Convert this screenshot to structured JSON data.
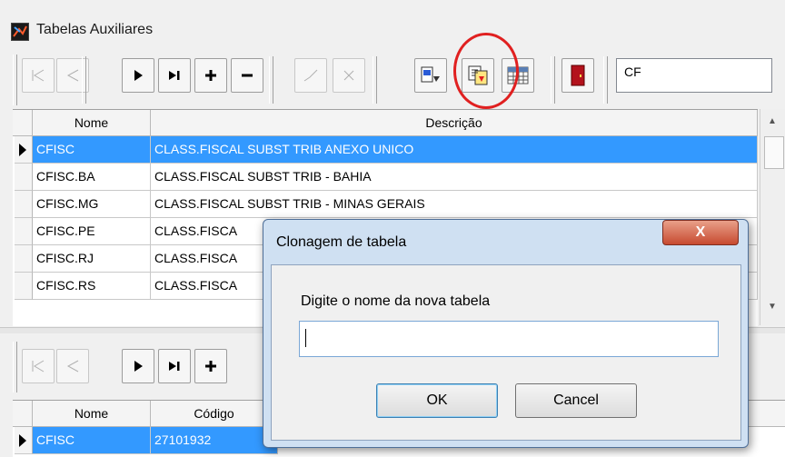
{
  "window": {
    "title": "Tabelas Auxiliares"
  },
  "toolbar_top": {
    "filter_value": "CF",
    "buttons": [
      "first-icon",
      "prior-icon",
      "next-icon",
      "last-icon",
      "plus-icon",
      "minus-icon",
      "edit-icon",
      "cancel-x-icon",
      "refresh-icon",
      "clone-table-icon",
      "grid-icon",
      "exit-door-icon"
    ]
  },
  "grid_top": {
    "columns": [
      "Nome",
      "Descrição"
    ],
    "rows": [
      [
        "CFISC",
        "CLASS.FISCAL SUBST TRIB ANEXO UNICO"
      ],
      [
        "CFISC.BA",
        "CLASS.FISCAL SUBST TRIB - BAHIA"
      ],
      [
        "CFISC.MG",
        "CLASS.FISCAL SUBST TRIB - MINAS GERAIS"
      ],
      [
        "CFISC.PE",
        "CLASS.FISCA"
      ],
      [
        "CFISC.RJ",
        "CLASS.FISCA"
      ],
      [
        "CFISC.RS",
        "CLASS.FISCA"
      ]
    ]
  },
  "grid_bottom": {
    "columns": [
      "Nome",
      "Código"
    ],
    "rows": [
      [
        "CFISC",
        "27101932"
      ]
    ]
  },
  "dialog": {
    "title": "Clonagem de tabela",
    "close_label": "X",
    "prompt": "Digite o nome da nova tabela",
    "input_value": "",
    "ok_label": "OK",
    "cancel_label": "Cancel"
  },
  "colors": {
    "selection": "#3399ff",
    "annotation": "#e02020"
  }
}
